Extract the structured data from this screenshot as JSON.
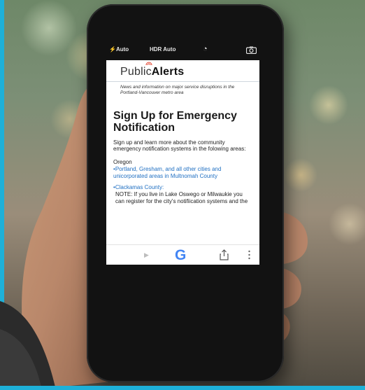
{
  "camera": {
    "flash_label": "Auto",
    "hdr_label": "HDR Auto"
  },
  "site": {
    "logo_prefix": "Public",
    "logo_strong": "Alerts",
    "tagline": "News and information on major service disruptions in the Portland-Vancouver metro area"
  },
  "content": {
    "headline": "Sign Up for Emergency Notification",
    "intro": "Sign up and learn more about the community emergency notification systems in the folowing areas:",
    "state": "Oregon",
    "link_multnomah": "Portland, Gresham, and all other cities and unicorporated areas in Multnomah County",
    "link_clackamas": "Clackamas County:",
    "note": "NOTE: If you live in Lake Oswego or Milwaukie you can register for the city's notifiication systems and the"
  },
  "toolbar": {
    "google_letter": "G"
  },
  "colors": {
    "link": "#1f6fc2",
    "border_accent": "#1eb0d8"
  }
}
